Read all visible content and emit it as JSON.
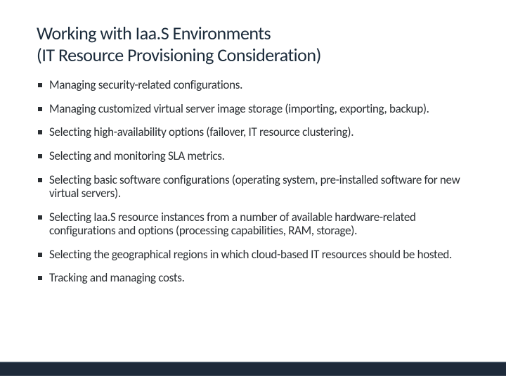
{
  "title_line1": "Working with Iaa.S Environments",
  "title_line2": "(IT Resource Provisioning Consideration)",
  "bullets": [
    "Managing security-related configurations.",
    "Managing customized virtual server image storage (importing, exporting, backup).",
    "Selecting high-availability options (failover, IT resource clustering).",
    "Selecting and monitoring SLA metrics.",
    "Selecting basic software configurations (operating system, pre-installed software for new virtual servers).",
    "Selecting Iaa.S resource instances from a number of available hardware-related configurations and options (processing capabilities, RAM, storage).",
    "Selecting the geographical regions in which cloud-based IT resources should be hosted.",
    "Tracking and managing costs."
  ]
}
